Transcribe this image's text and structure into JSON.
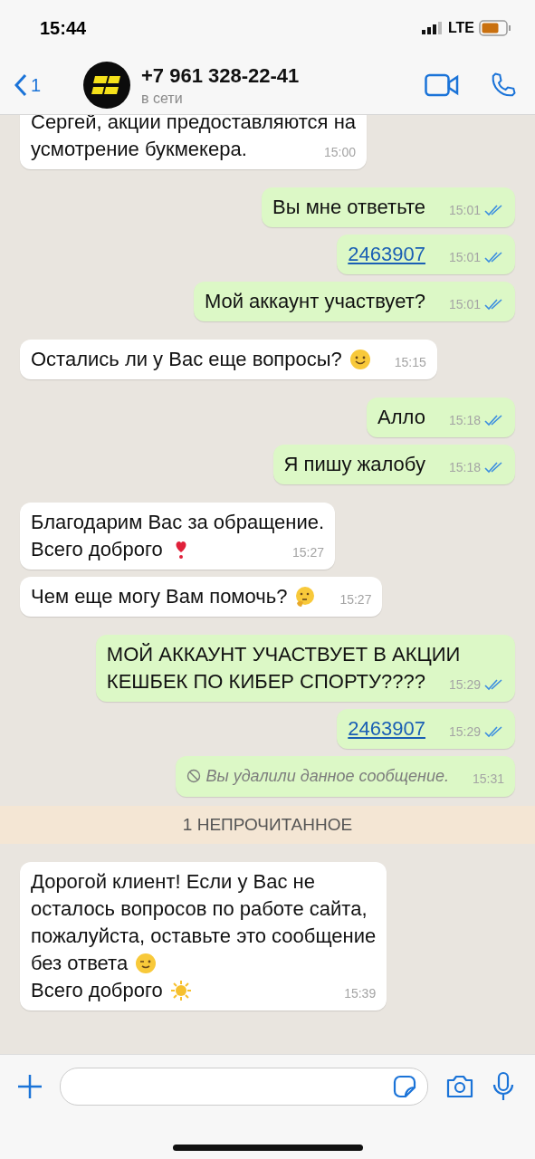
{
  "status_bar": {
    "time": "15:44",
    "network": "LTE"
  },
  "header": {
    "back_count": "1",
    "contact": "+7 961 328-22-41",
    "presence": "в сети"
  },
  "messages": [
    {
      "kind": "text",
      "outgoing": false,
      "lines": [
        {
          "text": "Сергей, акции предоставляются на"
        },
        {
          "text": "усмотрение букмекера."
        }
      ],
      "time": "15:00"
    },
    {
      "kind": "text",
      "outgoing": true,
      "lines": [
        {
          "text": "Вы мне ответьте"
        }
      ],
      "time": "15:01",
      "read": true
    },
    {
      "kind": "link",
      "outgoing": true,
      "lines": [
        {
          "text": "2463907"
        }
      ],
      "time": "15:01",
      "read": true
    },
    {
      "kind": "text",
      "outgoing": true,
      "lines": [
        {
          "text": "Мой аккаунт участвует?"
        }
      ],
      "time": "15:01",
      "read": true
    },
    {
      "kind": "text",
      "outgoing": false,
      "lines": [
        {
          "text": "Остались ли у Вас еще вопросы?",
          "emoji": {
            "kind": "smile"
          }
        }
      ],
      "time": "15:15"
    },
    {
      "kind": "text",
      "outgoing": true,
      "lines": [
        {
          "text": "Алло"
        }
      ],
      "time": "15:18",
      "read": true
    },
    {
      "kind": "text",
      "outgoing": true,
      "lines": [
        {
          "text": "Я пишу жалобу"
        }
      ],
      "time": "15:18",
      "read": true
    },
    {
      "kind": "text",
      "outgoing": false,
      "lines": [
        {
          "text": "Благодарим Вас за обращение."
        },
        {
          "text": "Всего доброго",
          "emoji": {
            "kind": "heart"
          }
        }
      ],
      "time": "15:27"
    },
    {
      "kind": "text",
      "outgoing": false,
      "lines": [
        {
          "text": "Чем еще могу Вам помочь?",
          "emoji": {
            "kind": "thinking"
          }
        }
      ],
      "time": "15:27"
    },
    {
      "kind": "text",
      "outgoing": true,
      "lines": [
        {
          "text": "МОЙ АККАУНТ УЧАСТВУЕТ В АКЦИИ"
        },
        {
          "text": "КЕШБЕК ПО КИБЕР СПОРТУ????"
        }
      ],
      "time": "15:29",
      "read": true
    },
    {
      "kind": "link",
      "outgoing": true,
      "lines": [
        {
          "text": "2463907"
        }
      ],
      "time": "15:29",
      "read": true
    },
    {
      "kind": "deleted",
      "outgoing": true,
      "lines": [
        {
          "text": "Вы удалили данное сообщение."
        }
      ],
      "time": "15:31"
    },
    {
      "kind": "banner",
      "text": "1 НЕПРОЧИТАННОЕ"
    },
    {
      "kind": "text",
      "outgoing": false,
      "lines": [
        {
          "text": "Дорогой клиент! Если у Вас не"
        },
        {
          "text": "осталось вопросов по работе сайта,"
        },
        {
          "text": "пожалуйста, оставьте это сообщение"
        },
        {
          "text": "без ответа",
          "emoji": {
            "kind": "wink"
          }
        },
        {
          "text": "Всего доброго",
          "emoji": {
            "kind": "sun"
          }
        }
      ],
      "time": "15:39"
    }
  ]
}
